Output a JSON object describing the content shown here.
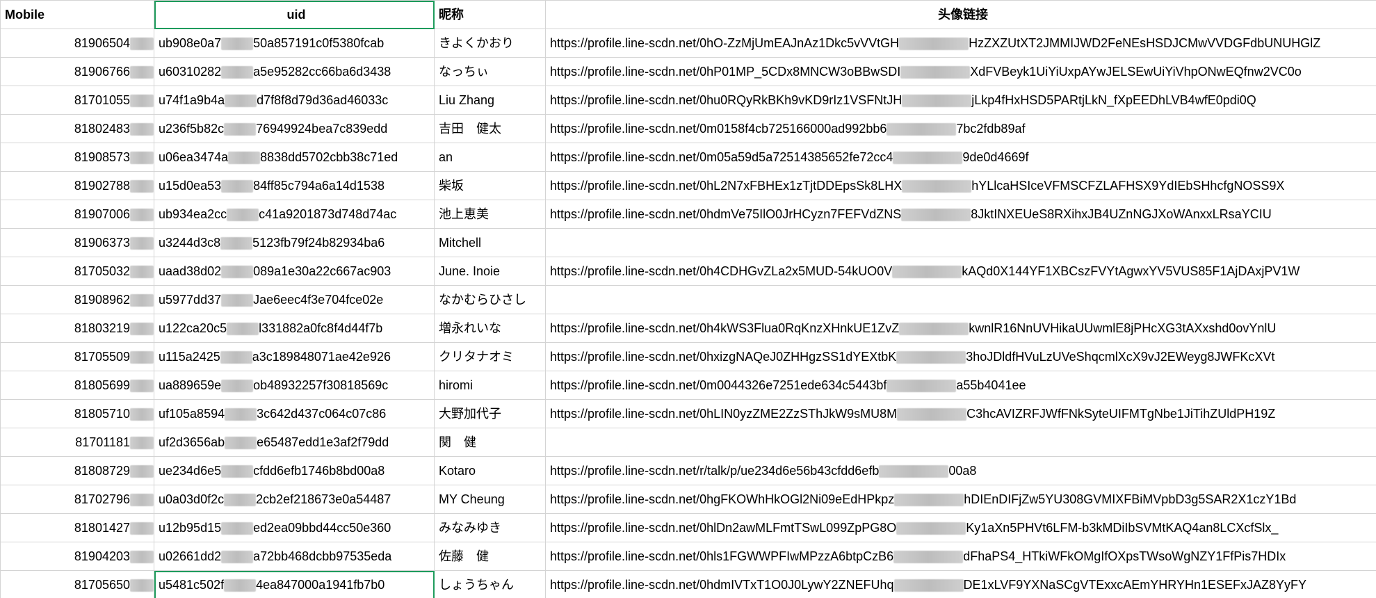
{
  "headers": {
    "mobile": "Mobile",
    "uid": "uid",
    "nickname": "昵称",
    "avatar": "头像链接"
  },
  "rows": [
    {
      "mobile": "81906504",
      "uid_a": "ub908e0a7",
      "uid_b": "50a857191c0f5380fcab",
      "nickname": "きよくかおり",
      "url_a": "https://profile.line-scdn.net/0hO-ZzMjUmEAJnAz1Dkc5vVVtGH",
      "url_b": "HzZXZUtXT2JMMIJWD2FeNEsHSDJCMwVVDGFdbUNUHGlZ"
    },
    {
      "mobile": "81906766",
      "uid_a": "u60310282",
      "uid_b": "a5e95282cc66ba6d3438",
      "nickname": "なっちぃ",
      "url_a": "https://profile.line-scdn.net/0hP01MP_5CDx8MNCW3oBBwSDI",
      "url_b": "XdFVBeyk1UiYiUxpAYwJELSEwUiYiVhpONwEQfnw2VC0o"
    },
    {
      "mobile": "81701055",
      "uid_a": "u74f1a9b4a",
      "uid_b": "d7f8f8d79d36ad46033c",
      "nickname": "Liu Zhang",
      "url_a": "https://profile.line-scdn.net/0hu0RQyRkBKh9vKD9rIz1VSFNtJH",
      "url_b": "jLkp4fHxHSD5PARtjLkN_fXpEEDhLVB4wfE0pdi0Q"
    },
    {
      "mobile": "81802483",
      "uid_a": "u236f5b82c",
      "uid_b": "76949924bea7c839edd",
      "nickname": "吉田　健太",
      "url_a": "https://profile.line-scdn.net/0m0158f4cb725166000ad992bb6",
      "url_b": "7bc2fdb89af"
    },
    {
      "mobile": "81908573",
      "uid_a": "u06ea3474a",
      "uid_b": "8838dd5702cbb38c71ed",
      "nickname": "an",
      "url_a": "https://profile.line-scdn.net/0m05a59d5a72514385652fe72cc4",
      "url_b": "9de0d4669f"
    },
    {
      "mobile": "81902788",
      "uid_a": "u15d0ea53",
      "uid_b": "84ff85c794a6a14d1538",
      "nickname": "柴坂",
      "url_a": "https://profile.line-scdn.net/0hL2N7xFBHEx1zTjtDDEpsSk8LHX",
      "url_b": "hYLlcaHSIceVFMSCFZLAFHSX9YdIEbSHhcfgNOSS9X"
    },
    {
      "mobile": "81907006",
      "uid_a": "ub934ea2cc",
      "uid_b": "c41a9201873d748d74ac",
      "nickname": "池上恵美",
      "url_a": "https://profile.line-scdn.net/0hdmVe75IlO0JrHCyzn7FEFVdZNS",
      "url_b": "8JktINXEUeS8RXihxJB4UZnNGJXoWAnxxLRsaYCIU"
    },
    {
      "mobile": "81906373",
      "uid_a": "u3244d3c8",
      "uid_b": "5123fb79f24b82934ba6",
      "nickname": "Mitchell",
      "url_a": "",
      "url_b": ""
    },
    {
      "mobile": "81705032",
      "uid_a": "uaad38d02",
      "uid_b": "089a1e30a22c667ac903",
      "nickname": "June. Inoie",
      "url_a": "https://profile.line-scdn.net/0h4CDHGvZLa2x5MUD-54kUO0V",
      "url_b": "kAQd0X144YF1XBCszFVYtAgwxYV5VUS85F1AjDAxjPV1W"
    },
    {
      "mobile": "81908962",
      "uid_a": "u5977dd37",
      "uid_b": "Jae6eec4f3e704fce02e",
      "nickname": "なかむらひさし",
      "url_a": "",
      "url_b": ""
    },
    {
      "mobile": "81803219",
      "uid_a": "u122ca20c5",
      "uid_b": "l331882a0fc8f4d44f7b",
      "nickname": "増永れいな",
      "url_a": "https://profile.line-scdn.net/0h4kWS3Flua0RqKnzXHnkUE1ZvZ",
      "url_b": "kwnlR16NnUVHikaUUwmlE8jPHcXG3tAXxshd0ovYnlU"
    },
    {
      "mobile": "81705509",
      "uid_a": "u115a2425",
      "uid_b": "a3c189848071ae42e926",
      "nickname": "クリタナオミ",
      "url_a": "https://profile.line-scdn.net/0hxizgNAQeJ0ZHHgzSS1dYEXtbK",
      "url_b": "3hoJDldfHVuLzUVeShqcmlXcX9vJ2EWeyg8JWFKcXVt"
    },
    {
      "mobile": "81805699",
      "uid_a": "ua889659e",
      "uid_b": "ob48932257f30818569c",
      "nickname": "hiromi",
      "url_a": "https://profile.line-scdn.net/0m0044326e7251ede634c5443bf",
      "url_b": "a55b4041ee"
    },
    {
      "mobile": "81805710",
      "uid_a": "uf105a8594",
      "uid_b": "3c642d437c064c07c86",
      "nickname": "大野加代子",
      "url_a": "https://profile.line-scdn.net/0hLIN0yzZME2ZzSThJkW9sMU8M",
      "url_b": "C3hcAVIZRFJWfFNkSyteUIFMTgNbe1JiTihZUldPH19Z"
    },
    {
      "mobile": "81701181",
      "uid_a": "uf2d3656ab",
      "uid_b": "e65487edd1e3af2f79dd",
      "nickname": "関　健",
      "url_a": "",
      "url_b": ""
    },
    {
      "mobile": "81808729",
      "uid_a": "ue234d6e5",
      "uid_b": "cfdd6efb1746b8bd00a8",
      "nickname": "Kotaro",
      "url_a": "https://profile.line-scdn.net/r/talk/p/ue234d6e56b43cfdd6efb",
      "url_b": "00a8"
    },
    {
      "mobile": "81702796",
      "uid_a": "u0a03d0f2c",
      "uid_b": "2cb2ef218673e0a54487",
      "nickname": "MY Cheung",
      "url_a": "https://profile.line-scdn.net/0hgFKOWhHkOGl2Ni09eEdHPkpz",
      "url_b": "hDIEnDIFjZw5YU308GVMIXFBiMVpbD3g5SAR2X1czY1Bd"
    },
    {
      "mobile": "81801427",
      "uid_a": "u12b95d15",
      "uid_b": "ed2ea09bbd44cc50e360",
      "nickname": "みなみゆき",
      "url_a": "https://profile.line-scdn.net/0hlDn2awMLFmtTSwL099ZpPG8O",
      "url_b": "Ky1aXn5PHVt6LFM-b3kMDiIbSVMtKAQ4an8LCXcfSlx_"
    },
    {
      "mobile": "81904203",
      "uid_a": "u02661dd2",
      "uid_b": "a72bb468dcbb97535eda",
      "nickname": "佐藤　健",
      "url_a": "https://profile.line-scdn.net/0hls1FGWWPFIwMPzzA6btpCzB6",
      "url_b": "dFhaPS4_HTkiWFkOMgIfOXpsTWsoWgNZY1FfPis7HDIx"
    },
    {
      "mobile": "81705650",
      "uid_a": "u5481c502f",
      "uid_b": "4ea847000a1941fb7b0",
      "nickname": "しょうちゃん",
      "url_a": "https://profile.line-scdn.net/0hdmIVTxT1O0J0LywY2ZNEFUhq",
      "url_b": "DE1xLVF9YXNaSCgVTExxcAEmYHRYHn1ESEFxJAZ8YyFY"
    }
  ]
}
